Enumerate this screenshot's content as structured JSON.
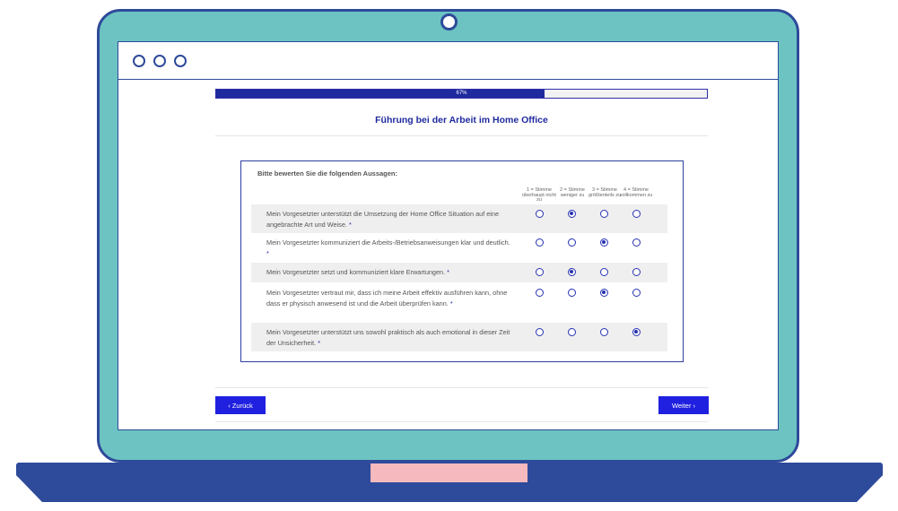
{
  "progress": {
    "value": 0.67,
    "label": "67%"
  },
  "survey": {
    "title": "Führung bei der Arbeit im Home Office",
    "instruction": "Bitte bewerten Sie die folgenden Aussagen:",
    "columns": [
      "1 = Stimme überhaupt nicht zu",
      "2 = Stimme weniger zu",
      "3 = Stimme größtenteils zu",
      "4 = Stimme vollkommen zu"
    ],
    "required_mark": "*",
    "rows": [
      {
        "text": "Mein Vorgesetzter unterstützt die Umsetzung der Home Office Situation auf eine angebrachte Art und Weise.",
        "selected": 2
      },
      {
        "text": "Mein Vorgesetzter kommuniziert die Arbeits-/Betriebsanweisungen klar und deutlich.",
        "selected": 3
      },
      {
        "text": "Mein Vorgesetzter setzt und kommuniziert klare Erwartungen.",
        "selected": 2
      },
      {
        "text": "Mein Vorgesetzter vertraut mir, dass ich meine Arbeit effektiv ausführen kann, ohne dass er physisch anwesend ist und die Arbeit überprüfen kann.",
        "selected": 3
      },
      {
        "text": "Mein Vorgesetzter unterstützt uns sowohl praktisch als auch emotional in dieser Zeit der Unsicherheit.",
        "selected": 4
      }
    ]
  },
  "nav": {
    "back_label": "‹ Zurück",
    "next_label": "Weiter ›"
  },
  "colors": {
    "accent": "#2020e0",
    "title": "#1f2a9e",
    "laptop_body": "#6cc3c2",
    "laptop_outline": "#2e4a9a",
    "trackpad": "#f5b9be"
  }
}
